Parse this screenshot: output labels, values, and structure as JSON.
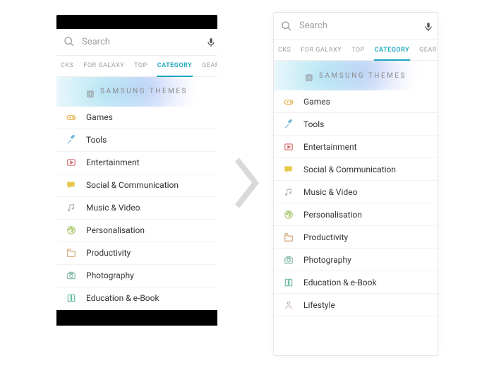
{
  "search": {
    "placeholder": "Search"
  },
  "tabs": {
    "clipped": "CKS",
    "forGalaxy": "FOR GALAXY",
    "top": "TOP",
    "category": "CATEGORY",
    "gear": "GEAR"
  },
  "hero": {
    "title": "SAMSUNG THEMES"
  },
  "iconColors": {
    "games": "#e4b04a",
    "tools": "#6bb6d6",
    "entertainment": "#d96b6b",
    "social": "#e6c94b",
    "music": "#b8c2c7",
    "personalisation": "#a7c76b",
    "productivity": "#d0a77a",
    "photography": "#7fb5a0",
    "education": "#6bbf9f",
    "lifestyle": "#c7a9b4"
  },
  "left": {
    "categories": [
      {
        "key": "games",
        "label": "Games"
      },
      {
        "key": "tools",
        "label": "Tools"
      },
      {
        "key": "entertainment",
        "label": "Entertainment"
      },
      {
        "key": "social",
        "label": "Social & Communication"
      },
      {
        "key": "music",
        "label": "Music & Video"
      },
      {
        "key": "personalisation",
        "label": "Personalisation"
      },
      {
        "key": "productivity",
        "label": "Productivity"
      },
      {
        "key": "photography",
        "label": "Photography"
      },
      {
        "key": "education",
        "label": "Education & e-Book"
      }
    ]
  },
  "right": {
    "categories": [
      {
        "key": "games",
        "label": "Games"
      },
      {
        "key": "tools",
        "label": "Tools"
      },
      {
        "key": "entertainment",
        "label": "Entertainment"
      },
      {
        "key": "social",
        "label": "Social & Communication"
      },
      {
        "key": "music",
        "label": "Music & Video"
      },
      {
        "key": "personalisation",
        "label": "Personalisation"
      },
      {
        "key": "productivity",
        "label": "Productivity"
      },
      {
        "key": "photography",
        "label": "Photography"
      },
      {
        "key": "education",
        "label": "Education & e-Book"
      },
      {
        "key": "lifestyle",
        "label": "Lifestyle"
      }
    ]
  }
}
